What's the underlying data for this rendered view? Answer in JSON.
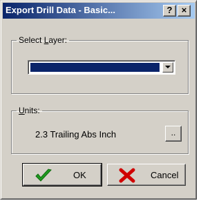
{
  "window": {
    "title": "Export Drill Data - Basic...",
    "help_label": "?",
    "close_label": "×"
  },
  "layer_group": {
    "label_prefix": "Select ",
    "label_accel": "L",
    "label_suffix": "ayer:",
    "selected_value": ""
  },
  "units_group": {
    "label_accel": "U",
    "label_suffix": "nits:",
    "value": "2.3 Trailing Abs Inch",
    "browse_label": ".."
  },
  "buttons": {
    "ok_label": "OK",
    "cancel_label": "Cancel"
  },
  "colors": {
    "ok_check": "#1f9a1f",
    "cancel_x": "#d00000",
    "selection": "#0a246a"
  },
  "icons": {
    "ok": "green-check-icon",
    "cancel": "red-x-icon"
  }
}
